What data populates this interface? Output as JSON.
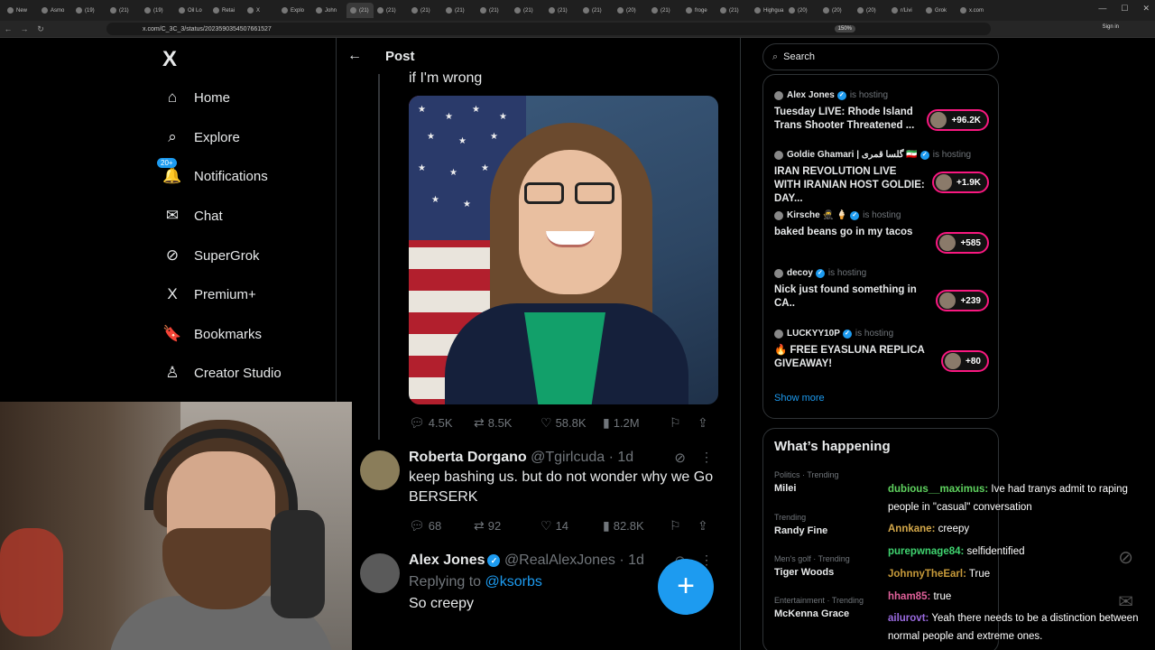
{
  "browser": {
    "tabs": [
      "New",
      "Asmo",
      "(19)",
      "(21)",
      "(19)",
      "Oil Lo",
      "Retai",
      "X",
      "Explo",
      "John",
      "(21)",
      "(21)",
      "(21)",
      "(21)",
      "(21)",
      "(21)",
      "(21)",
      "(21)",
      "(20)",
      "(21)",
      "froge",
      "(21)",
      "Highgua",
      "(20)",
      "(20)",
      "(20)",
      "r/Livi",
      "Grok",
      "x.com"
    ],
    "url": "x.com/C_3C_3/status/2023590354507661527",
    "zoom": "150%",
    "signin": "Sign in"
  },
  "nav": {
    "logo": "X",
    "items": [
      {
        "label": "Home",
        "icon": "⌂"
      },
      {
        "label": "Explore",
        "icon": "⌕"
      },
      {
        "label": "Notifications",
        "icon": "🔔"
      },
      {
        "label": "Chat",
        "icon": "✉"
      },
      {
        "label": "SuperGrok",
        "icon": "⊘"
      },
      {
        "label": "Premium+",
        "icon": "X"
      },
      {
        "label": "Bookmarks",
        "icon": "🔖"
      },
      {
        "label": "Creator Studio",
        "icon": "♙"
      }
    ],
    "notif_badge": "20+"
  },
  "main": {
    "title": "Post",
    "tweet_tail": "if I'm wrong",
    "post_stats": {
      "replies": "4.5K",
      "reposts": "8.5K",
      "likes": "58.8K",
      "views": "1.2M"
    },
    "replies": [
      {
        "name": "Roberta Dorgano",
        "handle": "@Tgirlcuda · 1d",
        "text": "keep bashing us. but do not wonder why we Go BERSERK",
        "stats": {
          "replies": "68",
          "reposts": "92",
          "likes": "14",
          "views": "82.8K"
        }
      },
      {
        "name": "Alex Jones",
        "handle": "@RealAlexJones · 1d",
        "replying_prefix": "Replying to ",
        "replying_to": "@ksorbs",
        "text": "So creepy"
      }
    ],
    "compose_icon": "+"
  },
  "right": {
    "search_placeholder": "Search",
    "spaces": [
      {
        "host": "Alex Jones",
        "status": "is hosting",
        "title": "Tuesday LIVE: Rhode Island Trans Shooter Threatened ...",
        "count": "+96.2K"
      },
      {
        "host": "Goldie Ghamari | گلسا قمری 🇮🇷",
        "status": "is hosting",
        "title": "IRAN REVOLUTION LIVE WITH IRANIAN HOST GOLDIE: DAY...",
        "count": "+1.9K"
      },
      {
        "host": "Kirsche 🥷 🍦",
        "status": "is hosting",
        "title": "baked beans go in my tacos",
        "count": "+585"
      },
      {
        "host": "decoy",
        "status": "is hosting",
        "title": "Nick just found something in CA..",
        "count": "+239"
      },
      {
        "host": "LUCKYY10P",
        "status": "is hosting",
        "title": "🔥 FREE EYASLUNA REPLICA GIVEAWAY!",
        "count": "+80"
      }
    ],
    "show_more": "Show more",
    "happening_title": "What’s happening",
    "trends": [
      {
        "category": "Politics · Trending",
        "name": "Milei"
      },
      {
        "category": "Trending",
        "name": "Randy Fine"
      },
      {
        "category": "Men's golf · Trending",
        "name": "Tiger Woods"
      },
      {
        "category": "Entertainment · Trending",
        "name": "McKenna Grace"
      }
    ]
  },
  "chat": [
    {
      "user": "dubious__maximus:",
      "text": " Ive had tranys admit to raping people in \"casual\" conversation",
      "color": "#5fd35f"
    },
    {
      "user": "Annkane:",
      "text": " creepy",
      "color": "#d4a84a"
    },
    {
      "user": "purepwnage84:",
      "text": " selfidentified",
      "color": "#3fd36f"
    },
    {
      "user": "JohnnyTheEarl:",
      "text": " True",
      "color": "#c79a3a"
    },
    {
      "user": "hham85:",
      "text": " true",
      "color": "#e0609a"
    },
    {
      "user": "ailurovt:",
      "text": " Yeah there needs to be a distinction between normal people and extreme ones.",
      "color": "#9a6ae0"
    }
  ]
}
